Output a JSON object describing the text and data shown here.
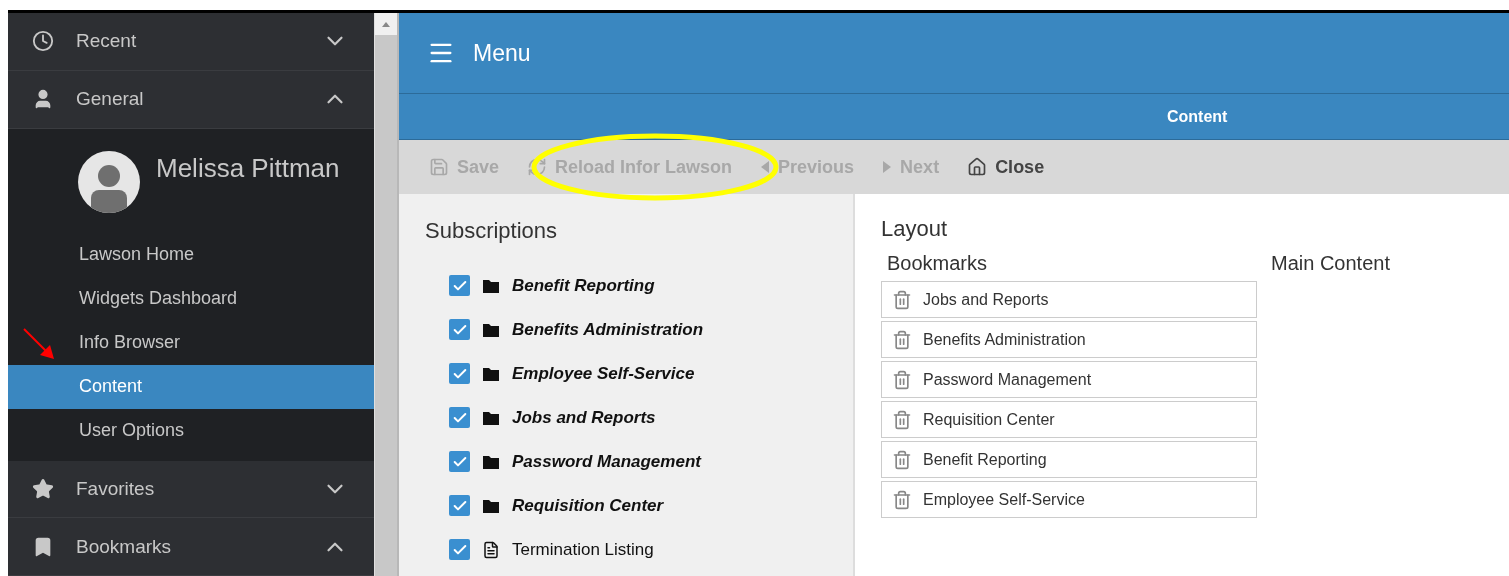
{
  "sidebar": {
    "sections": [
      {
        "kind": "recent",
        "label": "Recent",
        "expanded": false
      },
      {
        "kind": "general",
        "label": "General",
        "expanded": true,
        "user": {
          "name": "Melissa Pittman"
        },
        "items": [
          {
            "label": "Lawson Home",
            "selected": false
          },
          {
            "label": "Widgets Dashboard",
            "selected": false
          },
          {
            "label": "Info Browser",
            "selected": false
          },
          {
            "label": "Content",
            "selected": true
          },
          {
            "label": "User Options",
            "selected": false
          }
        ]
      },
      {
        "kind": "favorites",
        "label": "Favorites",
        "expanded": false
      },
      {
        "kind": "bookmarks",
        "label": "Bookmarks",
        "expanded": true
      }
    ]
  },
  "header": {
    "title": "Menu"
  },
  "subheader": {
    "title": "Content"
  },
  "toolbar": [
    {
      "kind": "save",
      "label": "Save",
      "disabled": true
    },
    {
      "kind": "reload",
      "label": "Reload Infor Lawson",
      "disabled": true
    },
    {
      "kind": "previous",
      "label": "Previous",
      "disabled": true
    },
    {
      "kind": "next",
      "label": "Next",
      "disabled": true
    },
    {
      "kind": "close",
      "label": "Close",
      "disabled": false
    }
  ],
  "subscriptions": {
    "title": "Subscriptions",
    "items": [
      {
        "kind": "folder",
        "label": "Benefit Reporting",
        "checked": true
      },
      {
        "kind": "folder",
        "label": "Benefits Administration",
        "checked": true
      },
      {
        "kind": "folder",
        "label": "Employee Self-Service",
        "checked": true
      },
      {
        "kind": "folder",
        "label": "Jobs and Reports",
        "checked": true
      },
      {
        "kind": "folder",
        "label": "Password Management",
        "checked": true
      },
      {
        "kind": "folder",
        "label": "Requisition Center",
        "checked": true
      },
      {
        "kind": "report",
        "label": "Termination Listing",
        "checked": true
      }
    ]
  },
  "layout": {
    "title": "Layout",
    "bookmarks_title": "Bookmarks",
    "main_title": "Main Content",
    "bookmarks": [
      "Jobs and Reports",
      "Benefits Administration",
      "Password Management",
      "Requisition Center",
      "Benefit Reporting",
      "Employee Self-Service"
    ]
  }
}
